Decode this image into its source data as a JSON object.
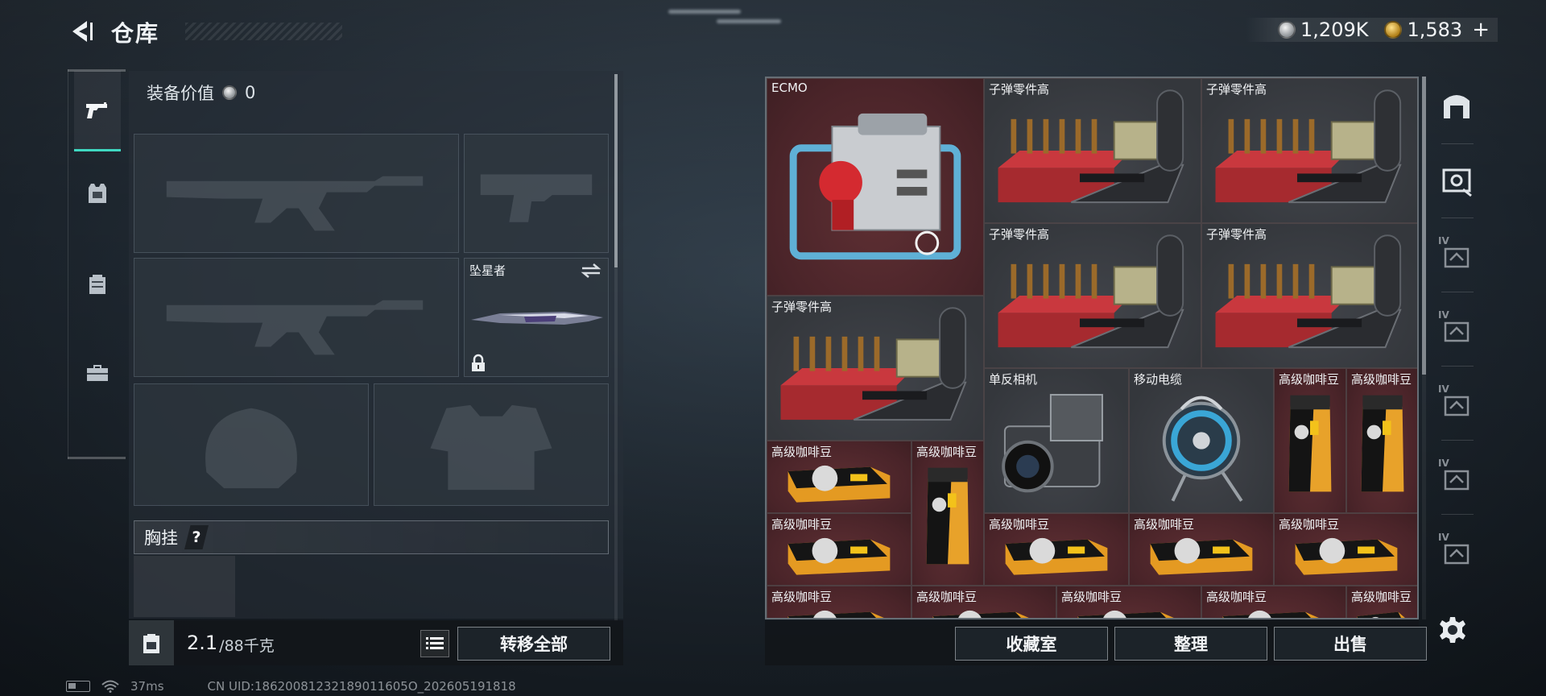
{
  "header": {
    "title": "仓库",
    "currency": [
      {
        "icon": "silver-coin-icon",
        "value": "1,209K"
      },
      {
        "icon": "gold-coin-icon",
        "value": "1,583"
      }
    ],
    "add_symbol": "+"
  },
  "left_tabs": [
    {
      "icon": "pistol-icon",
      "active": true
    },
    {
      "icon": "armor-vest-icon",
      "active": false
    },
    {
      "icon": "backpack-icon",
      "active": false
    },
    {
      "icon": "toolbox-icon",
      "active": false
    }
  ],
  "equipment": {
    "value_label": "装备价值",
    "value": "0",
    "melee_name": "坠星者",
    "chest_rig_label": "胸挂",
    "chest_rig_help": "?"
  },
  "weight": {
    "current": "2.1",
    "max": "/88千克"
  },
  "buttons": {
    "transfer_all": "转移全部",
    "collection_room": "收藏室",
    "organize": "整理",
    "sell": "出售"
  },
  "stash_items": [
    {
      "name": "ECMO",
      "art": "ecmo",
      "bg": "red"
    },
    {
      "name": "子弹零件高",
      "art": "ammo-parts",
      "bg": "dark"
    },
    {
      "name": "子弹零件高",
      "art": "ammo-parts",
      "bg": "dark"
    },
    {
      "name": "子弹零件高",
      "art": "ammo-parts",
      "bg": "dark"
    },
    {
      "name": "子弹零件高",
      "art": "ammo-parts",
      "bg": "dark"
    },
    {
      "name": "子弹零件高",
      "art": "ammo-parts",
      "bg": "dark"
    },
    {
      "name": "单反相机",
      "art": "camera",
      "bg": "dark"
    },
    {
      "name": "移动电缆",
      "art": "cable-reel",
      "bg": "dark"
    },
    {
      "name": "高级咖啡豆",
      "art": "coffee-bag",
      "bg": "red"
    },
    {
      "name": "高级咖啡豆",
      "art": "coffee-bag",
      "bg": "red"
    },
    {
      "name": "高级咖啡豆",
      "art": "coffee-box",
      "bg": "red"
    },
    {
      "name": "高级咖啡豆",
      "art": "coffee-bag",
      "bg": "red"
    },
    {
      "name": "高级咖啡豆",
      "art": "coffee-box",
      "bg": "red"
    },
    {
      "name": "高级咖啡豆",
      "art": "coffee-box",
      "bg": "red"
    },
    {
      "name": "高级咖啡豆",
      "art": "coffee-box",
      "bg": "red"
    },
    {
      "name": "高级咖啡豆",
      "art": "coffee-box",
      "bg": "red"
    },
    {
      "name": "高级咖啡豆",
      "art": "coffee-box",
      "bg": "red"
    },
    {
      "name": "高级咖啡豆",
      "art": "coffee-box",
      "bg": "red"
    },
    {
      "name": "高级咖啡豆",
      "art": "coffee-box",
      "bg": "red"
    },
    {
      "name": "高级咖啡豆",
      "art": "coffee-box",
      "bg": "red"
    },
    {
      "name": "高级咖啡豆",
      "art": "coffee-box",
      "bg": "red"
    }
  ],
  "right_tabs": [
    {
      "icon": "arch-icon",
      "label": ""
    },
    {
      "icon": "safe-box-icon",
      "label": ""
    },
    {
      "icon": "container-iv-1-icon",
      "label": "IV"
    },
    {
      "icon": "container-iv-2-icon",
      "label": "IV"
    },
    {
      "icon": "container-iv-3-icon",
      "label": "IV"
    },
    {
      "icon": "container-iv-4-icon",
      "label": "IV"
    },
    {
      "icon": "container-iv-5-icon",
      "label": "IV"
    }
  ],
  "status_bar": {
    "ping": "37ms",
    "uid": "CN UID:18620081232189011605O_202605191818"
  },
  "colors": {
    "accent": "#3fd8c1",
    "item_bg_red": "#4a2429",
    "item_bg_dark": "#34373c"
  }
}
